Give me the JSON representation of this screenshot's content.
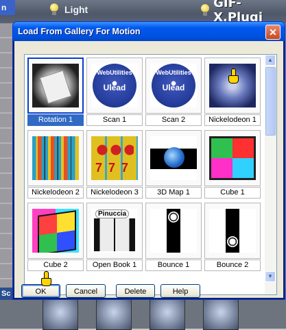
{
  "app": {
    "left_tab_fragment": "n",
    "light_label": "Light",
    "plugin_label": "GIF-X.Plugi",
    "bottom_tab_fragment": "Sc"
  },
  "dialog": {
    "title": "Load From Gallery For Motion",
    "close_glyph": "✕"
  },
  "gallery": {
    "selected_index": 0,
    "items": [
      {
        "label": "Rotation 1",
        "icon": "rotation-thumbnail"
      },
      {
        "label": "Scan 1",
        "icon": "ulead-disc-thumbnail",
        "text": "WebUtilities"
      },
      {
        "label": "Scan 2",
        "icon": "ulead-disc-thumbnail",
        "text": "WebUtilities"
      },
      {
        "label": "Nickelodeon 1",
        "icon": "nickelodeon-thumbnail"
      },
      {
        "label": "Nickelodeon 2",
        "icon": "nickelodeon-stripes-thumbnail"
      },
      {
        "label": "Nickelodeon 3",
        "icon": "slot-machine-thumbnail"
      },
      {
        "label": "3D Map 1",
        "icon": "globe-thumbnail"
      },
      {
        "label": "Cube 1",
        "icon": "cube-thumbnail"
      },
      {
        "label": "Cube 2",
        "icon": "cube-thumbnail"
      },
      {
        "label": "Open Book 1",
        "icon": "book-thumbnail",
        "text": "Pinuccia"
      },
      {
        "label": "Bounce 1",
        "icon": "soccer-ball-thumbnail"
      },
      {
        "label": "Bounce 2",
        "icon": "soccer-ball-thumbnail"
      }
    ],
    "ulead_brand": "Ulead"
  },
  "buttons": {
    "ok": "OK",
    "cancel": "Cancel",
    "delete": "Delete",
    "help": "Help"
  },
  "colors": {
    "title_bar": "#0054e3",
    "selection": "#316ac5"
  }
}
